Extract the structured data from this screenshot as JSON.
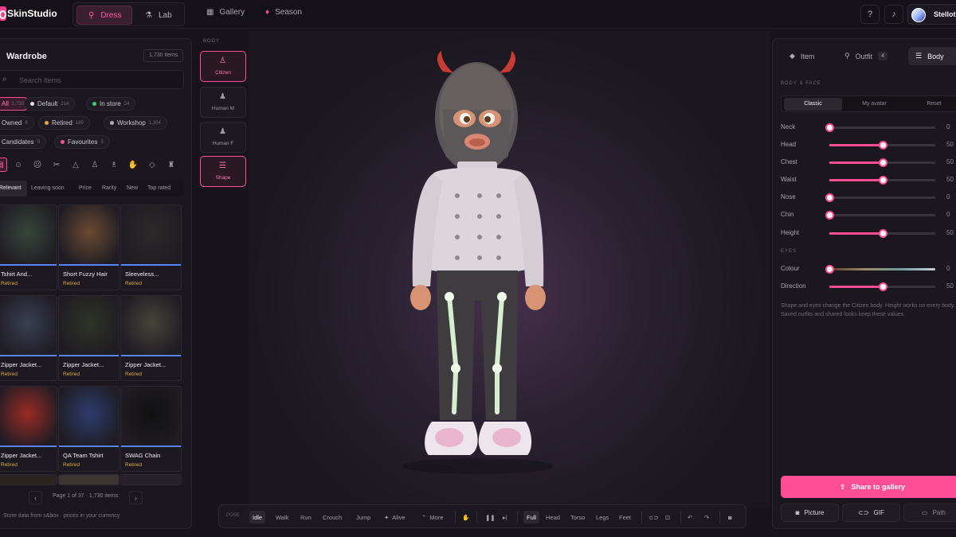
{
  "app": {
    "name": "SkinStudio"
  },
  "topbar": {
    "modes": [
      {
        "label": "Dress",
        "icon": "hanger-icon"
      },
      {
        "label": "Lab",
        "icon": "flask-icon"
      }
    ],
    "nav": [
      {
        "label": "Gallery",
        "icon": "grid-icon"
      },
      {
        "label": "Season",
        "icon": "trophy-icon"
      }
    ],
    "user": {
      "name": "Stellot"
    }
  },
  "wardrobe": {
    "title": "Wardrobe",
    "count": "1,730 items",
    "search_placeholder": "Search items",
    "filters": [
      {
        "label": "All",
        "count": "1,730",
        "color": "#ff4d94",
        "active": true
      },
      {
        "label": "Default",
        "count": "214",
        "color": "#e4e0e8"
      },
      {
        "label": "In store",
        "count": "24",
        "color": "#3dd17c"
      },
      {
        "label": "Owned",
        "count": "8",
        "color": "#5585ff"
      },
      {
        "label": "Retired",
        "count": "189",
        "color": "#e8a83a"
      },
      {
        "label": "Workshop",
        "count": "1,304",
        "color": "#b4aebc"
      },
      {
        "label": "Candidates",
        "count": "0",
        "color": "#e8a83a"
      },
      {
        "label": "Favourites",
        "count": "3",
        "color": "#ff4d94"
      }
    ],
    "sort_options": [
      "Relevant",
      "Leaving soon",
      "Price",
      "Rarity",
      "New",
      "Top rated"
    ],
    "items": [
      {
        "name": "Tshirt And...",
        "status": "Retired"
      },
      {
        "name": "Short Fuzzy Hair",
        "status": "Retired"
      },
      {
        "name": "Sleeveless...",
        "status": "Retired"
      },
      {
        "name": "Zipper Jacket...",
        "status": "Retired"
      },
      {
        "name": "Zipper Jacket...",
        "status": "Retired"
      },
      {
        "name": "Zipper Jacket...",
        "status": "Retired"
      },
      {
        "name": "Zipper Jacket...",
        "status": "Retired"
      },
      {
        "name": "QA Team Tshirt",
        "status": "Retired"
      },
      {
        "name": "SWAG Chain",
        "status": "Retired"
      }
    ],
    "pager": "Page 1 of 37 · 1,730 items",
    "store_note": "Store data from s&box · prices in your currency"
  },
  "body_panel": {
    "label": "BODY",
    "options": [
      {
        "label": "Citizen",
        "active": true
      },
      {
        "label": "Human M"
      },
      {
        "label": "Human F"
      },
      {
        "label": "Shape",
        "active": true
      }
    ]
  },
  "bottom_bar": {
    "pose_label": "POSE",
    "poses": [
      "Idle",
      "Walk",
      "Run",
      "Crouch",
      "Jump",
      "Alive",
      "More"
    ],
    "views": [
      "Full",
      "Head",
      "Torso",
      "Legs",
      "Feet"
    ]
  },
  "right_panel": {
    "tabs": [
      {
        "label": "Item"
      },
      {
        "label": "Outfit",
        "badge": "4"
      },
      {
        "label": "Body"
      }
    ],
    "section_body": "BODY & FACE",
    "presets": [
      "Classic",
      "My avatar",
      "Reset"
    ],
    "sliders": [
      {
        "label": "Neck",
        "value": 0,
        "display": "0"
      },
      {
        "label": "Head",
        "value": 50,
        "display": "50"
      },
      {
        "label": "Chest",
        "value": 50,
        "display": "50"
      },
      {
        "label": "Waist",
        "value": 50,
        "display": "50"
      },
      {
        "label": "Nose",
        "value": 0,
        "display": "0"
      },
      {
        "label": "Chin",
        "value": 0,
        "display": "0"
      }
    ],
    "height": {
      "label": "Height",
      "value": 50,
      "display": "50"
    },
    "section_eyes": "EYES",
    "eye_sliders": [
      {
        "label": "Colour",
        "value": 0,
        "display": "0"
      },
      {
        "label": "Direction",
        "value": 50,
        "display": "50"
      }
    ],
    "note": "Shape and eyes change the Citizen body. Height works on every body. Saved outfits and shared looks keep these values.",
    "share": "Share to gallery",
    "actions": [
      "Picture",
      "GIF",
      "Path"
    ]
  }
}
